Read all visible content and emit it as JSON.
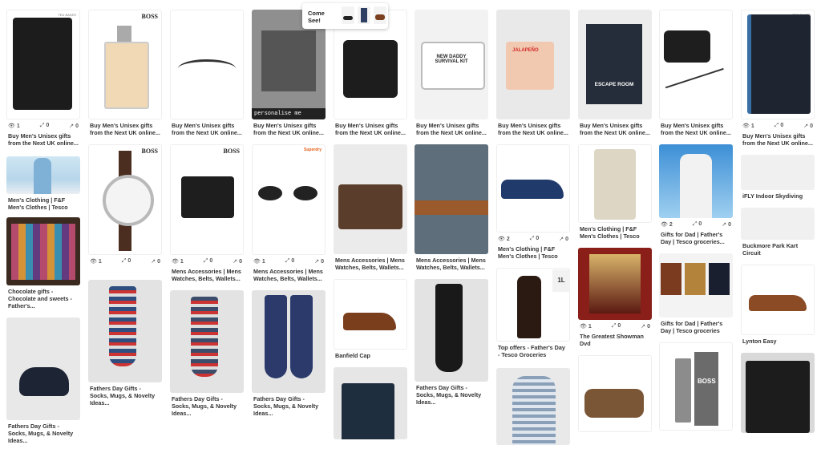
{
  "popup": {
    "text": "Come See!"
  },
  "columns": [
    {
      "pins": [
        {
          "t": "Buy Men's Unisex gifts from the Next UK online...",
          "st": [
            "1",
            "0",
            "0"
          ],
          "b": "TED BAKER"
        },
        {
          "t": "Men's Clothing | F&F Men's Clothes | Tesco"
        },
        {
          "t": "Chocolate gifts - Chocolate and sweets - Father's..."
        },
        {
          "t": "Fathers Day Gifts - Socks, Mugs, & Novelty Ideas..."
        }
      ]
    },
    {
      "pins": [
        {
          "t": "Buy Men's Unisex gifts from the Next UK online...",
          "b": "BOSS"
        },
        {
          "t": "",
          "st": [
            "1",
            "0",
            "0"
          ],
          "b": "BOSS"
        },
        {
          "t": "Fathers Day Gifts - Socks, Mugs, & Novelty Ideas..."
        }
      ]
    },
    {
      "pins": [
        {
          "t": "Buy Men's Unisex gifts from the Next UK online..."
        },
        {
          "t": "Mens Accessories | Mens Watches, Belts, Wallets...",
          "st": [
            "1",
            "0",
            "0"
          ],
          "b": "BOSS"
        },
        {
          "t": "Fathers Day Gifts - Socks, Mugs, & Novelty Ideas..."
        }
      ]
    },
    {
      "pins": [
        {
          "t": "Buy Men's Unisex gifts from the Next UK online...",
          "cap": "personalise me"
        },
        {
          "t": "Mens Accessories | Mens Watches, Belts, Wallets...",
          "st": [
            "1",
            "0",
            "0"
          ],
          "b": "Superdry"
        },
        {
          "t": "Fathers Day Gifts - Socks, Mugs, & Novelty Ideas..."
        }
      ]
    },
    {
      "pins": [
        {
          "t": "Buy Men's Unisex gifts from the Next UK online..."
        },
        {
          "t": "Mens Accessories | Mens Watches, Belts, Wallets..."
        },
        {
          "t": "Banfield Cap"
        },
        {
          "t": ""
        }
      ]
    },
    {
      "pins": [
        {
          "t": "Buy Men's Unisex gifts from the Next UK online...",
          "kit": "NEW DADDY SURVIVAL KIT"
        },
        {
          "t": "Mens Accessories | Mens Watches, Belts, Wallets..."
        },
        {
          "t": "Fathers Day Gifts - Socks, Mugs, & Novelty Ideas..."
        }
      ]
    },
    {
      "pins": [
        {
          "t": "Buy Men's Unisex gifts from the Next UK online...",
          "b": "JALAPEÑO"
        },
        {
          "t": "Men's Clothing | F&F Men's Clothes | Tesco",
          "st": [
            "2",
            "0",
            "0"
          ]
        },
        {
          "t": "Top offers - Father's Day - Tesco Groceries",
          "tag": "1L"
        },
        {
          "t": ""
        }
      ]
    },
    {
      "pins": [
        {
          "t": "Buy Men's Unisex gifts from the Next UK online...",
          "kit": "ESCAPE ROOM"
        },
        {
          "t": "Men's Clothing | F&F Men's Clothes | Tesco"
        },
        {
          "t": "The Greatest Showman Dvd",
          "st": [
            "1",
            "0",
            "0"
          ]
        },
        {
          "t": ""
        }
      ]
    },
    {
      "pins": [
        {
          "t": "Buy Men's Unisex gifts from the Next UK online..."
        },
        {
          "t": "Gifts for Dad | Father's Day | Tesco groceries...",
          "st": [
            "2",
            "0",
            "0"
          ]
        },
        {
          "t": "Gifts for Dad | Father's Day | Tesco groceries"
        },
        {
          "t": "",
          "b": "BOSS"
        }
      ]
    },
    {
      "pins": [
        {
          "t": "Buy Men's Unisex gifts from the Next UK online...",
          "st": [
            "1",
            "0",
            "0"
          ],
          "b": "TED BAKER"
        },
        {
          "t": "iFLY Indoor Skydiving"
        },
        {
          "t": "Buckmore Park Kart Circuit"
        },
        {
          "t": "Lynton Easy"
        },
        {
          "t": ""
        }
      ]
    }
  ]
}
